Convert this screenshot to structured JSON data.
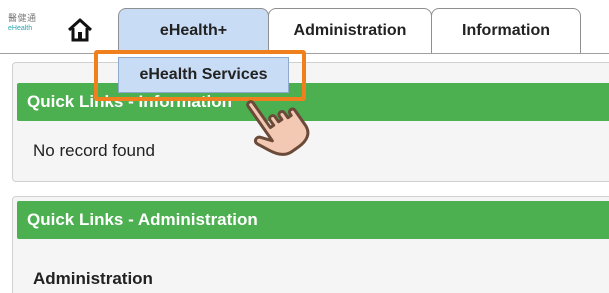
{
  "header": {
    "logo": {
      "cn": "醫健通",
      "en": "eHealth"
    },
    "tabs": [
      {
        "label": "eHealth+",
        "active": true
      },
      {
        "label": "Administration",
        "active": false
      },
      {
        "label": "Information",
        "active": false
      }
    ]
  },
  "dropdown": {
    "items": [
      "eHealth Services"
    ]
  },
  "panels": [
    {
      "title": "Quick Links - Information",
      "body": "No record found"
    },
    {
      "title": "Quick Links - Administration",
      "body": "Administration"
    }
  ],
  "colors": {
    "active_tab": "#c9dcf5",
    "panel_header": "#4caf50",
    "highlight": "#f07f1e"
  },
  "icons": {
    "home": "home-icon",
    "cursor": "hand-pointer-icon"
  }
}
